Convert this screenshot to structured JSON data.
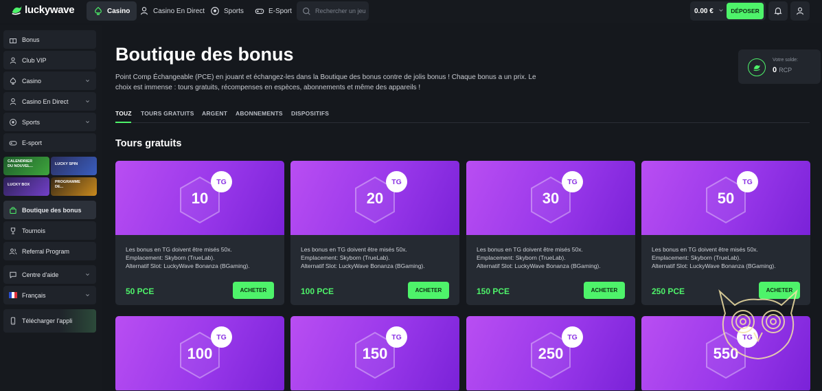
{
  "header": {
    "logo_text": "luckywave",
    "nav": [
      {
        "label": "Casino",
        "icon": "spade-icon",
        "active": true
      },
      {
        "label": "Casino En Direct",
        "icon": "dealer-icon"
      },
      {
        "label": "Sports",
        "icon": "ball-icon"
      },
      {
        "label": "E-Sport",
        "icon": "gamepad-icon"
      }
    ],
    "search_placeholder": "Rechercher un jeu",
    "balance": "0.00 €",
    "deposit_label": "DÉPOSER",
    "icons": {
      "notifications": "bell-icon",
      "profile": "user-icon"
    }
  },
  "sidebar": {
    "items": [
      {
        "label": "Bonus",
        "icon": "gift-icon"
      },
      {
        "label": "Club VIP",
        "icon": "user-icon"
      },
      {
        "label": "Casino",
        "icon": "spade-icon",
        "has_chevron": true
      },
      {
        "label": "Casino En Direct",
        "icon": "dealer-icon",
        "has_chevron": true
      },
      {
        "label": "Sports",
        "icon": "ball-icon",
        "has_chevron": true
      },
      {
        "label": "E-sport",
        "icon": "gamepad-icon"
      }
    ],
    "promos": [
      {
        "label": "CALENDRIER DU NOUVEL..."
      },
      {
        "label": "LUCKY SPIN"
      },
      {
        "label": "LUCKY BOX"
      },
      {
        "label": "PROGRAMME DE..."
      }
    ],
    "items2": [
      {
        "label": "Boutique des bonus",
        "icon": "bag-icon",
        "active": true
      },
      {
        "label": "Tournois",
        "icon": "trophy-icon"
      },
      {
        "label": "Referral Program",
        "icon": "users-icon"
      },
      {
        "label": "Centre d'aide",
        "icon": "chat-icon",
        "has_chevron": true
      },
      {
        "label": "Français",
        "icon": "flag-fr-icon",
        "has_chevron": true
      },
      {
        "label": "Télécharger l'appli",
        "icon": "phone-icon"
      }
    ]
  },
  "main": {
    "title": "Boutique des bonus",
    "description": "Point Comp Échangeable (PCE) en jouant et échangez-les dans la Boutique des bonus contre de jolis bonus ! Chaque bonus a un prix. Le choix est immense : tours gratuits, récompenses en espèces, abonnements et même des appareils !",
    "solde_label": "Votre solde:",
    "solde_value": "0",
    "solde_unit": "RCP",
    "tabs": [
      "TOUZ",
      "TOURS GRATUITS",
      "ARGENT",
      "ABONNEMENTS",
      "DISPOSITIFS"
    ],
    "section_title": "Tours gratuits",
    "card_desc_1": "Les bonus en TG doivent être misés 50x.",
    "card_desc_2": "Emplacement: Skyborn (TrueLab).",
    "card_desc_3": "Alternatif Slot: LuckyWave Bonanza (BGaming).",
    "buy_label": "ACHETER",
    "badge": "TG",
    "cards": [
      {
        "value": "10",
        "price": "50 PCE"
      },
      {
        "value": "20",
        "price": "100 PCE"
      },
      {
        "value": "30",
        "price": "150 PCE"
      },
      {
        "value": "50",
        "price": "250 PCE"
      },
      {
        "value": "100"
      },
      {
        "value": "150"
      },
      {
        "value": "250"
      },
      {
        "value": "550"
      }
    ]
  },
  "colors": {
    "accent": "#4ef36a",
    "card_purple": "#9938ea",
    "background": "#15181d"
  }
}
